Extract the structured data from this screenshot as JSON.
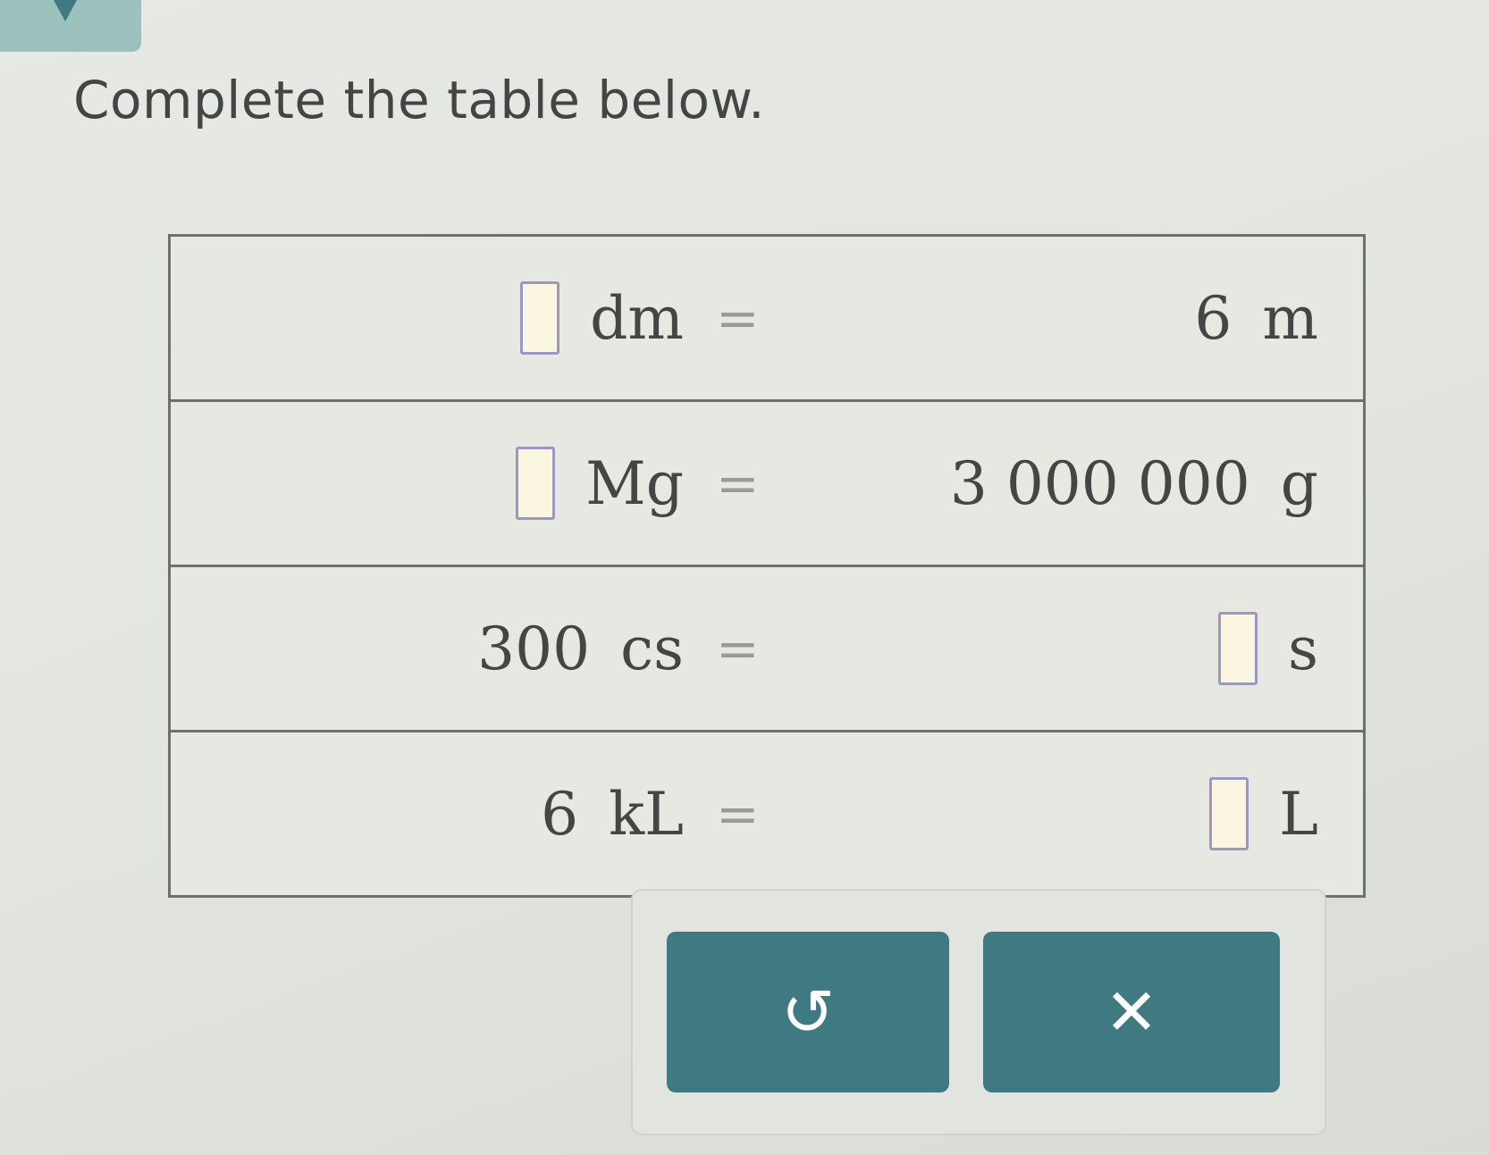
{
  "prompt": "Complete the table below.",
  "table": {
    "rows": [
      {
        "left_value": "",
        "left_unit": "dm",
        "equals": "=",
        "right_value": "6",
        "right_unit": "m"
      },
      {
        "left_value": "",
        "left_unit": "Mg",
        "equals": "=",
        "right_value": "3 000 000",
        "right_unit": "g"
      },
      {
        "left_value": "300",
        "left_unit": "cs",
        "equals": "=",
        "right_value": "",
        "right_unit": "s"
      },
      {
        "left_value": "6",
        "left_unit": "kL",
        "equals": "=",
        "right_value": "",
        "right_unit": "L"
      }
    ]
  },
  "buttons": {
    "undo_icon": "↺",
    "clear_icon": "✕"
  },
  "colors": {
    "button": "#3f7a82",
    "input_border": "#9a97c4",
    "input_fill": "#fbf6df",
    "tab": "#9dc2bd"
  }
}
